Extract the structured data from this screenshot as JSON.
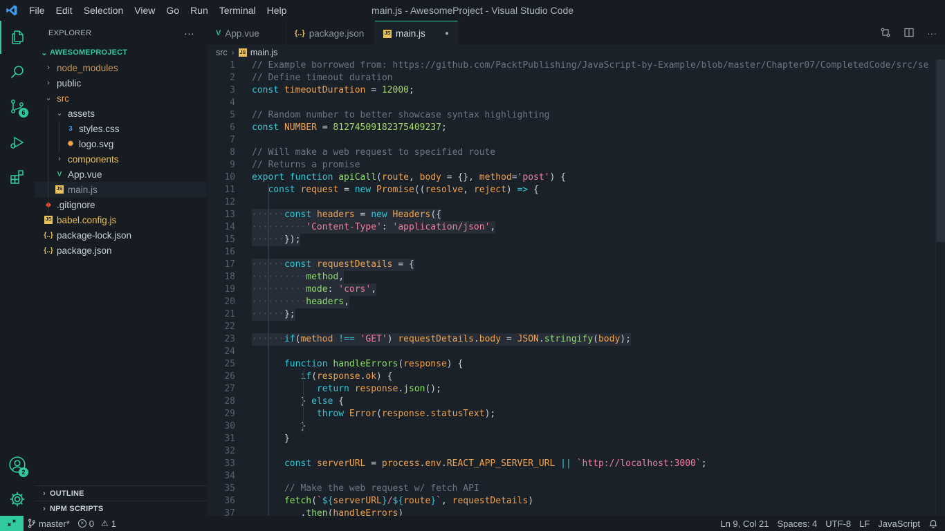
{
  "window_title": "main.js - AwesomeProject - Visual Studio Code",
  "menu": [
    "File",
    "Edit",
    "Selection",
    "View",
    "Go",
    "Run",
    "Terminal",
    "Help"
  ],
  "activity": {
    "scm_badge": "6",
    "accounts_badge": "2"
  },
  "sidebar": {
    "title": "EXPLORER",
    "more": "···",
    "root": "AWESOMEPROJECT",
    "items": [
      {
        "label": "node_modules",
        "type": "folder",
        "expanded": false,
        "level": 0,
        "color": "#c8975a"
      },
      {
        "label": "public",
        "type": "folder",
        "expanded": false,
        "level": 0,
        "color": "#c9d1d9"
      },
      {
        "label": "src",
        "type": "folder",
        "expanded": true,
        "level": 0,
        "color": "#f0a24e"
      },
      {
        "label": "assets",
        "type": "folder",
        "expanded": true,
        "level": 1,
        "color": "#c9d1d9"
      },
      {
        "label": "styles.css",
        "type": "file",
        "icon": "css",
        "level": 2,
        "color": "#c9d1d9"
      },
      {
        "label": "logo.svg",
        "type": "file",
        "icon": "svg",
        "level": 2,
        "color": "#c9d1d9"
      },
      {
        "label": "components",
        "type": "folder",
        "expanded": false,
        "level": 1,
        "color": "#e8c15a"
      },
      {
        "label": "App.vue",
        "type": "file",
        "icon": "vue",
        "level": 1,
        "color": "#c9d1d9"
      },
      {
        "label": "main.js",
        "type": "file",
        "icon": "js",
        "level": 1,
        "color": "#8d96a1",
        "selected": true
      },
      {
        "label": ".gitignore",
        "type": "file",
        "icon": "git",
        "level": 0,
        "color": "#c9d1d9"
      },
      {
        "label": "babel.config.js",
        "type": "file",
        "icon": "js",
        "level": 0,
        "color": "#e8c15a"
      },
      {
        "label": "package-lock.json",
        "type": "file",
        "icon": "json",
        "level": 0,
        "color": "#c9d1d9"
      },
      {
        "label": "package.json",
        "type": "file",
        "icon": "json",
        "level": 0,
        "color": "#c9d1d9"
      }
    ],
    "outline": "OUTLINE",
    "npm_scripts": "NPM SCRIPTS"
  },
  "tabs": [
    {
      "label": "App.vue",
      "icon": "vue",
      "active": false
    },
    {
      "label": "package.json",
      "icon": "json",
      "active": false
    },
    {
      "label": "main.js",
      "icon": "js",
      "active": true,
      "dirty": true
    }
  ],
  "breadcrumb": {
    "folder": "src",
    "file": "main.js"
  },
  "code_lines": [
    [
      [
        "cm",
        "// Example borrowed from: https://github.com/PacktPublishing/JavaScript-by-Example/blob/master/Chapter07/CompletedCode/src/se"
      ]
    ],
    [
      [
        "cm",
        "// Define timeout duration"
      ]
    ],
    [
      [
        "kw",
        "const "
      ],
      [
        "vr",
        "timeoutDuration"
      ],
      [
        "pc",
        " = "
      ],
      [
        "nm",
        "12000"
      ],
      [
        "pc",
        ";"
      ]
    ],
    [],
    [
      [
        "cm",
        "// Random number to better showcase syntax highlighting"
      ]
    ],
    [
      [
        "kw",
        "const "
      ],
      [
        "vr",
        "NUMBER"
      ],
      [
        "pc",
        " = "
      ],
      [
        "nm",
        "81274509182375409237"
      ],
      [
        "pc",
        ";"
      ]
    ],
    [],
    [
      [
        "cm",
        "// Will make a web request to specified route"
      ]
    ],
    [
      [
        "cm",
        "// Returns a promise"
      ]
    ],
    [
      [
        "kw",
        "export function "
      ],
      [
        "fn",
        "apiCall"
      ],
      [
        "pc",
        "("
      ],
      [
        "vr",
        "route"
      ],
      [
        "pc",
        ", "
      ],
      [
        "vr",
        "body"
      ],
      [
        "pc",
        " = {}, "
      ],
      [
        "vr",
        "method"
      ],
      [
        "pc",
        "="
      ],
      [
        "st",
        "'post'"
      ],
      [
        "pc",
        ") {"
      ]
    ],
    [
      [
        "pc",
        "   "
      ],
      [
        "kw",
        "const "
      ],
      [
        "vr",
        "request"
      ],
      [
        "pc",
        " = "
      ],
      [
        "kw",
        "new "
      ],
      [
        "ty",
        "Promise"
      ],
      [
        "pc",
        "(("
      ],
      [
        "vr",
        "resolve"
      ],
      [
        "pc",
        ", "
      ],
      [
        "vr",
        "reject"
      ],
      [
        "pc",
        ") "
      ],
      [
        "op",
        "=>"
      ],
      [
        "pc",
        " {"
      ]
    ],
    [],
    [
      [
        "ws",
        "······"
      ],
      [
        "kw",
        "const "
      ],
      [
        "vr",
        "headers"
      ],
      [
        "pc",
        " = "
      ],
      [
        "kw",
        "new "
      ],
      [
        "ty",
        "Headers"
      ],
      [
        "pc",
        "({"
      ]
    ],
    [
      [
        "ws",
        "··········"
      ],
      [
        "st",
        "'Content-Type'"
      ],
      [
        "pc",
        ": "
      ],
      [
        "st",
        "'application/json'"
      ],
      [
        "pc",
        ","
      ]
    ],
    [
      [
        "ws",
        "······"
      ],
      [
        "pc",
        "});"
      ]
    ],
    [],
    [
      [
        "ws",
        "······"
      ],
      [
        "kw",
        "const "
      ],
      [
        "vr",
        "requestDetails"
      ],
      [
        "pc",
        " = {"
      ]
    ],
    [
      [
        "ws",
        "··········"
      ],
      [
        "fn",
        "method"
      ],
      [
        "pc",
        ","
      ]
    ],
    [
      [
        "ws",
        "··········"
      ],
      [
        "fn",
        "mode"
      ],
      [
        "pc",
        ": "
      ],
      [
        "st",
        "'cors'"
      ],
      [
        "pc",
        ","
      ]
    ],
    [
      [
        "ws",
        "··········"
      ],
      [
        "fn",
        "headers"
      ],
      [
        "pc",
        ","
      ]
    ],
    [
      [
        "ws",
        "······"
      ],
      [
        "pc",
        "};"
      ]
    ],
    [],
    [
      [
        "ws",
        "······"
      ],
      [
        "kw",
        "if"
      ],
      [
        "pc",
        "("
      ],
      [
        "vr",
        "method"
      ],
      [
        "op",
        " !== "
      ],
      [
        "st",
        "'GET'"
      ],
      [
        "pc",
        ") "
      ],
      [
        "vr",
        "requestDetails"
      ],
      [
        "pc",
        "."
      ],
      [
        "vr",
        "body"
      ],
      [
        "pc",
        " = "
      ],
      [
        "ty",
        "JSON"
      ],
      [
        "pc",
        "."
      ],
      [
        "fn",
        "stringify"
      ],
      [
        "pc",
        "("
      ],
      [
        "vr",
        "body"
      ],
      [
        "pc",
        ");"
      ]
    ],
    [],
    [
      [
        "pc",
        "      "
      ],
      [
        "kw",
        "function "
      ],
      [
        "fn",
        "handleErrors"
      ],
      [
        "pc",
        "("
      ],
      [
        "vr",
        "response"
      ],
      [
        "pc",
        ") {"
      ]
    ],
    [
      [
        "pc",
        "         "
      ],
      [
        "kw",
        "if"
      ],
      [
        "pc",
        "("
      ],
      [
        "vr",
        "response"
      ],
      [
        "pc",
        "."
      ],
      [
        "vr",
        "ok"
      ],
      [
        "pc",
        ") {"
      ]
    ],
    [
      [
        "pc",
        "            "
      ],
      [
        "kw",
        "return "
      ],
      [
        "vr",
        "response"
      ],
      [
        "pc",
        "."
      ],
      [
        "fn",
        "json"
      ],
      [
        "pc",
        "();"
      ]
    ],
    [
      [
        "pc",
        "         } "
      ],
      [
        "kw",
        "else"
      ],
      [
        "pc",
        " {"
      ]
    ],
    [
      [
        "pc",
        "            "
      ],
      [
        "kw",
        "throw "
      ],
      [
        "ty",
        "Error"
      ],
      [
        "pc",
        "("
      ],
      [
        "vr",
        "response"
      ],
      [
        "pc",
        "."
      ],
      [
        "vr",
        "statusText"
      ],
      [
        "pc",
        ");"
      ]
    ],
    [
      [
        "pc",
        "         }"
      ]
    ],
    [
      [
        "pc",
        "      }"
      ]
    ],
    [],
    [
      [
        "pc",
        "      "
      ],
      [
        "kw",
        "const "
      ],
      [
        "vr",
        "serverURL"
      ],
      [
        "pc",
        " = "
      ],
      [
        "vr",
        "process"
      ],
      [
        "pc",
        "."
      ],
      [
        "vr",
        "env"
      ],
      [
        "pc",
        "."
      ],
      [
        "vr",
        "REACT_APP_SERVER_URL"
      ],
      [
        "op",
        " || "
      ],
      [
        "st",
        "`http://localhost:3000`"
      ],
      [
        "pc",
        ";"
      ]
    ],
    [],
    [
      [
        "pc",
        "      "
      ],
      [
        "cm",
        "// Make the web request w/ fetch API"
      ]
    ],
    [
      [
        "pc",
        "      "
      ],
      [
        "fn",
        "fetch"
      ],
      [
        "pc",
        "("
      ],
      [
        "st",
        "`"
      ],
      [
        "kw",
        "${"
      ],
      [
        "vr",
        "serverURL"
      ],
      [
        "kw",
        "}"
      ],
      [
        "st",
        "/"
      ],
      [
        "kw",
        "${"
      ],
      [
        "vr",
        "route"
      ],
      [
        "kw",
        "}"
      ],
      [
        "st",
        "`"
      ],
      [
        "pc",
        ", "
      ],
      [
        "vr",
        "requestDetails"
      ],
      [
        "pc",
        ")"
      ]
    ],
    [
      [
        "pc",
        "         ."
      ],
      [
        "fn",
        "then"
      ],
      [
        "pc",
        "("
      ],
      [
        "vr",
        "handleErrors"
      ],
      [
        "pc",
        ")"
      ]
    ]
  ],
  "highlighted_lines": [
    13,
    14,
    15,
    17,
    18,
    19,
    20,
    21,
    23
  ],
  "status": {
    "branch": "master*",
    "errors": "0",
    "warnings": "1",
    "cursor": "Ln 9, Col 21",
    "spaces": "Spaces: 4",
    "encoding": "UTF-8",
    "eol": "LF",
    "language": "JavaScript"
  },
  "colors": {
    "accent": "#30c9a0",
    "background": "#171c23",
    "editor_bg": "#1b2129"
  }
}
